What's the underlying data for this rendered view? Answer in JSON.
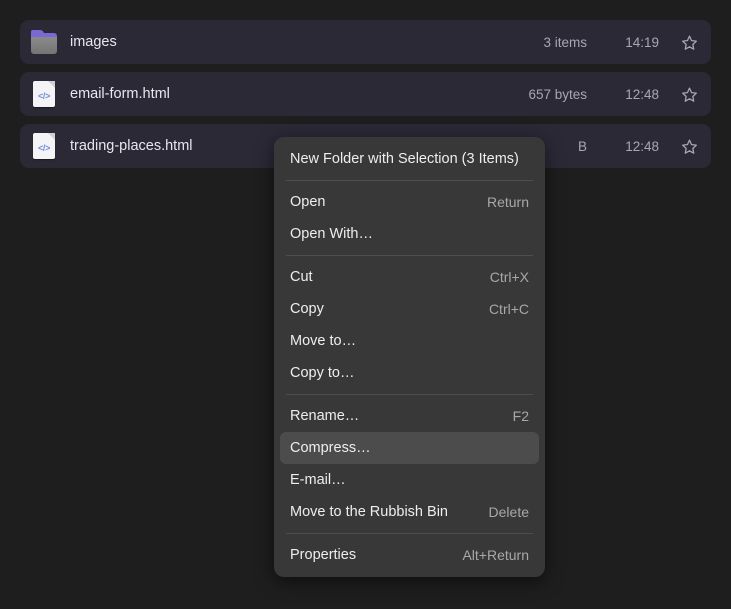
{
  "file_list": {
    "rows": [
      {
        "icon": "folder-icon",
        "name": "images",
        "size": "3 items",
        "time": "14:19",
        "star": "star-outline-icon"
      },
      {
        "icon": "html-file-icon",
        "icon_glyph": "</>",
        "name": "email-form.html",
        "size": "657 bytes",
        "time": "12:48",
        "star": "star-outline-icon"
      },
      {
        "icon": "html-file-icon",
        "icon_glyph": "</>",
        "name": "trading-places.html",
        "size": "B",
        "time": "12:48",
        "star": "star-outline-icon"
      }
    ]
  },
  "context_menu": {
    "groups": [
      {
        "items": [
          {
            "label": "New Folder with Selection (3 Items)",
            "accel": "",
            "highlighted": false
          }
        ]
      },
      {
        "items": [
          {
            "label": "Open",
            "accel": "Return",
            "highlighted": false
          },
          {
            "label": "Open With…",
            "accel": "",
            "highlighted": false
          }
        ]
      },
      {
        "items": [
          {
            "label": "Cut",
            "accel": "Ctrl+X",
            "highlighted": false
          },
          {
            "label": "Copy",
            "accel": "Ctrl+C",
            "highlighted": false
          },
          {
            "label": "Move to…",
            "accel": "",
            "highlighted": false
          },
          {
            "label": "Copy to…",
            "accel": "",
            "highlighted": false
          }
        ]
      },
      {
        "items": [
          {
            "label": "Rename…",
            "accel": "F2",
            "highlighted": false
          },
          {
            "label": "Compress…",
            "accel": "",
            "highlighted": true
          },
          {
            "label": "E-mail…",
            "accel": "",
            "highlighted": false
          },
          {
            "label": "Move to the Rubbish Bin",
            "accel": "Delete",
            "highlighted": false
          }
        ]
      },
      {
        "items": [
          {
            "label": "Properties",
            "accel": "Alt+Return",
            "highlighted": false
          }
        ]
      }
    ]
  },
  "colors": {
    "background": "#1e1e1e",
    "row_background": "#2c2937",
    "menu_background": "#383838",
    "menu_highlight": "#4c4c4c",
    "folder_accent": "#7b68d4",
    "code_glyph": "#6f8fd8",
    "primary_text": "#e8e6ee",
    "secondary_text": "#a9a5b5"
  }
}
